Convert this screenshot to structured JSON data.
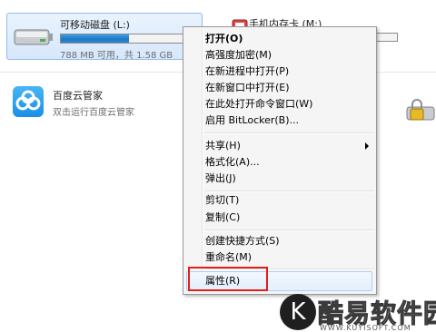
{
  "drives": {
    "removable": {
      "name": "可移动磁盘 (L:)",
      "space": "788 MB 可用，共 1.58 GB",
      "used_fraction": 0.5
    },
    "phone": {
      "name": "手机内存卡 (M:)"
    }
  },
  "apps": {
    "baidu": {
      "name": "百度云管家",
      "desc": "双击运行百度云管家"
    }
  },
  "context_menu": {
    "items": {
      "open": "打开(O)",
      "encrypt": "高强度加密(M)",
      "open_new_process": "在新进程中打开(P)",
      "open_new_window": "在新窗口中打开(E)",
      "open_cmd": "在此处打开命令窗口(W)",
      "bitlocker": "启用 BitLocker(B)...",
      "share": "共享(H)",
      "format": "格式化(A)...",
      "eject": "弹出(J)",
      "cut": "剪切(T)",
      "copy": "复制(C)",
      "create_shortcut": "创建快捷方式(S)",
      "rename": "重命名(M)",
      "properties": "属性(R)"
    }
  },
  "watermark": {
    "logo_letter": "K",
    "brand": "酷易软件园",
    "url": "WWW.KUYISOFT.COM"
  },
  "colors": {
    "highlight_box": "#e0201b",
    "progress": "#1d78c8"
  }
}
